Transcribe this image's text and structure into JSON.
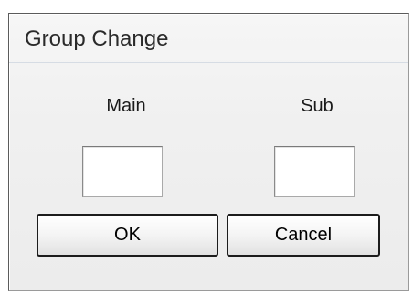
{
  "dialog": {
    "title": "Group Change",
    "main_label": "Main",
    "sub_label": "Sub",
    "main_value": "",
    "sub_value": "",
    "ok_label": "OK",
    "cancel_label": "Cancel"
  }
}
